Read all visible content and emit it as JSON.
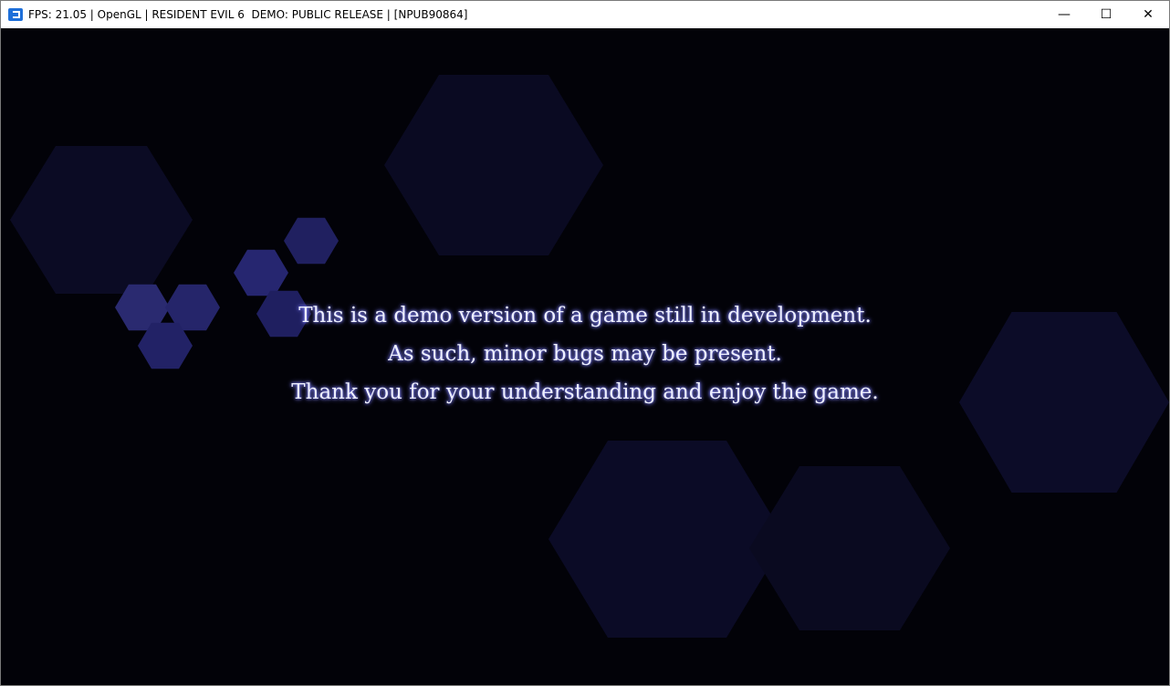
{
  "window": {
    "title": "FPS: 21.05 | OpenGL | RESIDENT EVIL 6  DEMO: PUBLIC RELEASE | [NPUB90864]",
    "minimize": "—",
    "maximize": "☐",
    "close": "✕"
  },
  "game": {
    "lines": [
      "This is a demo version of a game still in development.",
      "As such, minor bugs may be present.",
      "Thank you for your understanding and enjoy the game."
    ]
  }
}
